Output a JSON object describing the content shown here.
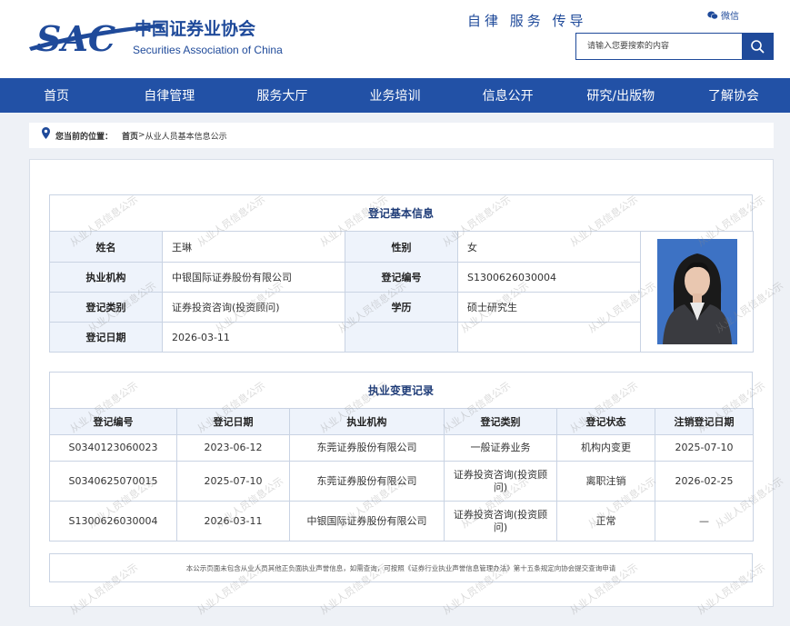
{
  "header": {
    "logo": {
      "mark": "SAC",
      "cn_name": "中国证券业协会",
      "en_name": "Securities Association of China"
    },
    "slogan": "自律  服务  传导",
    "wechat_label": "微信",
    "search_placeholder": "请输入您要搜索的内容"
  },
  "nav": [
    "首页",
    "自律管理",
    "服务大厅",
    "业务培训",
    "信息公开",
    "研究/出版物",
    "了解协会"
  ],
  "breadcrumb": {
    "label": "您当前的位置：",
    "home": "首页",
    "separator": ">",
    "current": "从业人员基本信息公示"
  },
  "basic_info": {
    "title": "登记基本信息",
    "labels": {
      "name": "姓名",
      "gender": "性别",
      "org": "执业机构",
      "reg_no": "登记编号",
      "category": "登记类别",
      "education": "学历",
      "date": "登记日期"
    },
    "values": {
      "name": "王琳",
      "gender": "女",
      "org": "中银国际证券股份有限公司",
      "reg_no": "S1300626030004",
      "category": "证券投资咨询(投资顾问)",
      "education": "硕士研究生",
      "date": "2026-03-11"
    }
  },
  "change_records": {
    "title": "执业变更记录",
    "columns": [
      "登记编号",
      "登记日期",
      "执业机构",
      "登记类别",
      "登记状态",
      "注销登记日期"
    ],
    "rows": [
      [
        "S0340123060023",
        "2023-06-12",
        "东莞证券股份有限公司",
        "一般证券业务",
        "机构内变更",
        "2025-07-10"
      ],
      [
        "S0340625070015",
        "2025-07-10",
        "东莞证券股份有限公司",
        "证券投资咨询(投资顾问)",
        "离职注销",
        "2026-02-25"
      ],
      [
        "S1300626030004",
        "2026-03-11",
        "中银国际证券股份有限公司",
        "证券投资咨询(投资顾问)",
        "正常",
        "—"
      ]
    ]
  },
  "notice": "本公示页面未包含从业人员其他正负面执业声誉信息，如需查询，可按照《证券行业执业声誉信息管理办法》第十五条规定向协会提交查询申请",
  "watermark": "从业人员信息公示",
  "colors": {
    "brand": "#1f4a9a",
    "nav": "#2251a6",
    "label_bg": "#eef3fb",
    "border": "#c9d3e3"
  }
}
